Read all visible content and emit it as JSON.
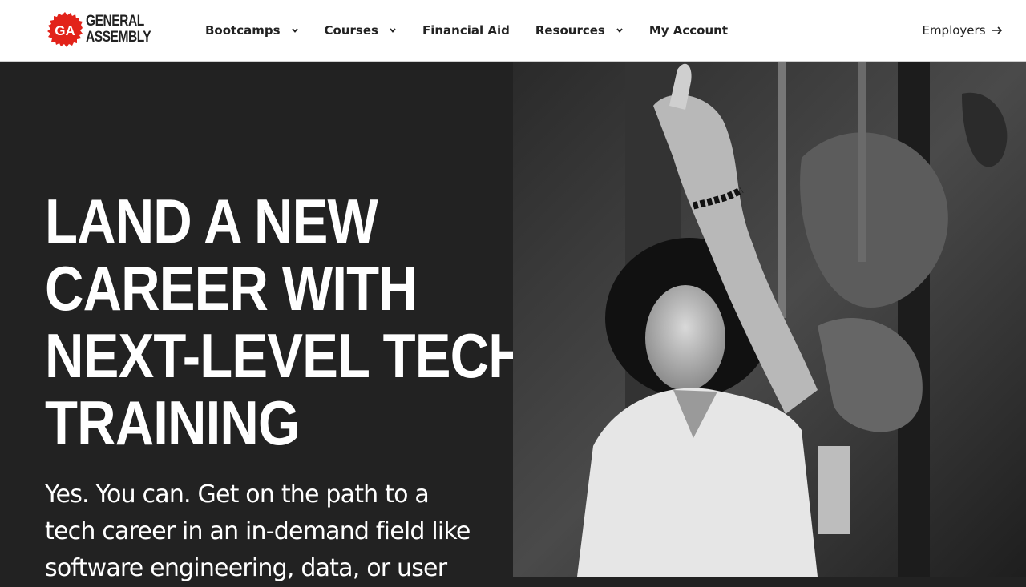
{
  "brand": {
    "name_line1": "GENERAL",
    "name_line2": "ASSEMBLY",
    "badge": "GA",
    "accent": "#E2231A"
  },
  "nav": {
    "items": [
      {
        "label": "Bootcamps",
        "has_dropdown": true
      },
      {
        "label": "Courses",
        "has_dropdown": true
      },
      {
        "label": "Financial Aid",
        "has_dropdown": false
      },
      {
        "label": "Resources",
        "has_dropdown": true
      },
      {
        "label": "My Account",
        "has_dropdown": false
      }
    ],
    "employers_label": "Employers"
  },
  "hero": {
    "title_lines": [
      "LAND A NEW",
      "CAREER WITH",
      "NEXT-LEVEL TECH",
      "TRAINING"
    ],
    "subtitle": "Yes. You can. Get on the path to a tech career in an in-demand field like software engineering, data, or user"
  },
  "colors": {
    "background": "#222222",
    "text": "#ffffff",
    "header_bg": "#ffffff"
  }
}
